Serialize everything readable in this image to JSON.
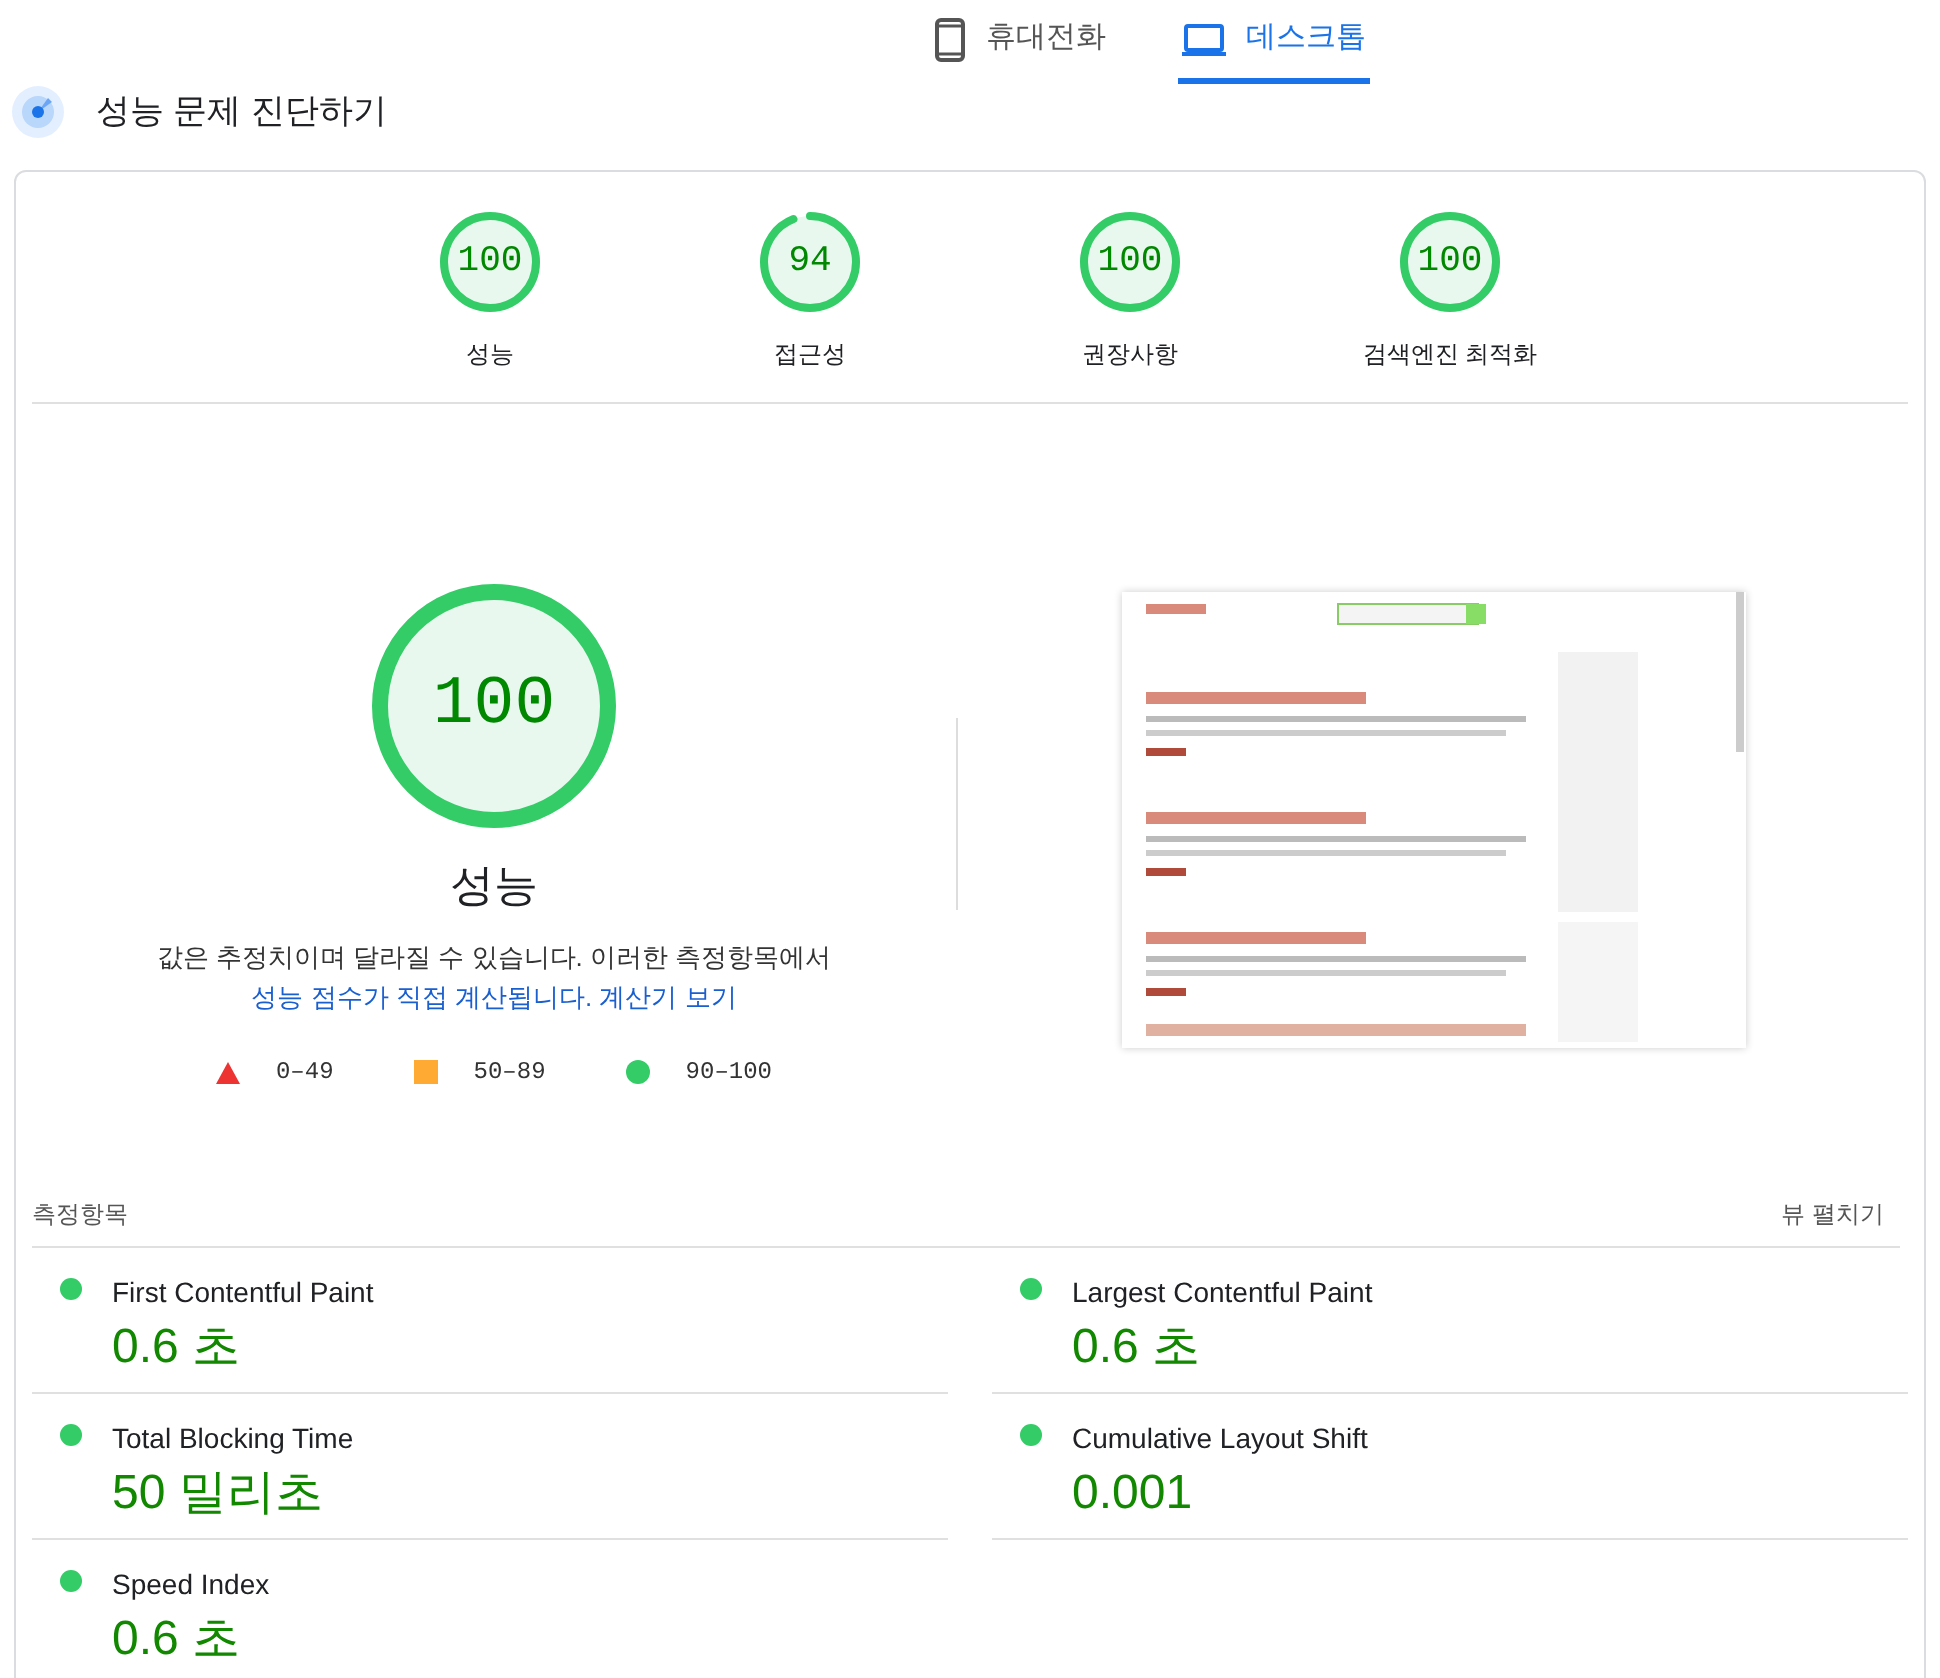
{
  "tabs": [
    {
      "kind": "phone",
      "label": "휴대전화",
      "selected": false
    },
    {
      "kind": "laptop",
      "label": "데스크톱",
      "selected": true
    }
  ],
  "heading": "성능 문제 진단하기",
  "scores": [
    {
      "score": "100",
      "label": "성능"
    },
    {
      "score": "94",
      "label": "접근성"
    },
    {
      "score": "100",
      "label": "권장사항"
    },
    {
      "score": "100",
      "label": "검색엔진 최적화"
    }
  ],
  "main_score": {
    "score": "100",
    "title": "성능"
  },
  "description": {
    "text": "값은 추정치이며 달라질 수 있습니다. 이러한 측정항목에서",
    "link": "성능 점수가 직접 계산됩니다.",
    "calculator_link": "계산기 보기"
  },
  "legend": [
    {
      "kind": "triangle",
      "color": "#ee3333",
      "label": "0–49"
    },
    {
      "kind": "square",
      "color": "#ffaa33",
      "label": "50–89"
    },
    {
      "kind": "circle",
      "color": "#33cc66",
      "label": "90–100"
    }
  ],
  "metrics_header": {
    "title": "측정항목",
    "expand": "뷰 펼치기"
  },
  "metrics": [
    {
      "name": "First Contentful Paint",
      "value": "0.6 초",
      "color": "#33cc66"
    },
    {
      "name": "Largest Contentful Paint",
      "value": "0.6 초",
      "color": "#33cc66"
    },
    {
      "name": "Total Blocking Time",
      "value": "50 밀리초",
      "color": "#33cc66"
    },
    {
      "name": "Cumulative Layout Shift",
      "value": "0.001",
      "color": "#33cc66"
    },
    {
      "name": "Speed Index",
      "value": "0.6 초",
      "color": "#33cc66"
    }
  ]
}
